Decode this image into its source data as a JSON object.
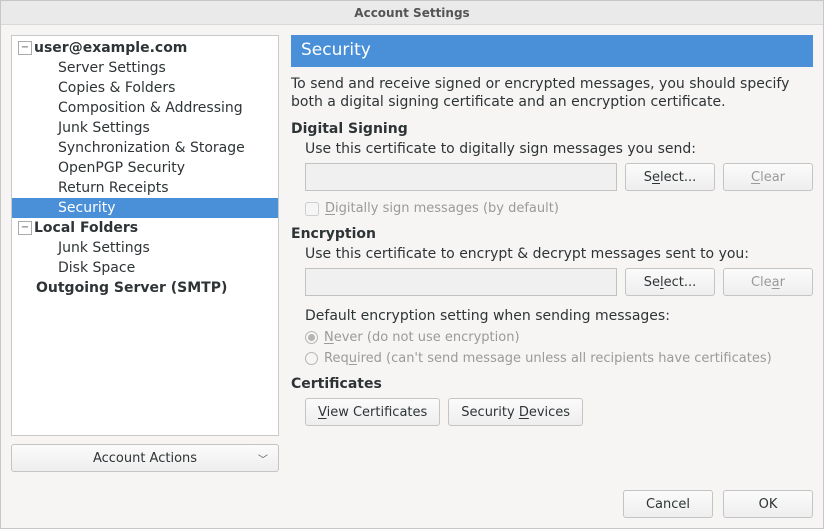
{
  "window": {
    "title": "Account Settings"
  },
  "tree": {
    "accounts": [
      {
        "label": "user@example.com",
        "expanded": true,
        "children": [
          {
            "label": "Server Settings"
          },
          {
            "label": "Copies & Folders"
          },
          {
            "label": "Composition & Addressing"
          },
          {
            "label": "Junk Settings"
          },
          {
            "label": "Synchronization & Storage"
          },
          {
            "label": "OpenPGP Security"
          },
          {
            "label": "Return Receipts"
          },
          {
            "label": "Security",
            "selected": true
          }
        ]
      },
      {
        "label": "Local Folders",
        "expanded": true,
        "children": [
          {
            "label": "Junk Settings"
          },
          {
            "label": "Disk Space"
          }
        ]
      },
      {
        "label": "Outgoing Server (SMTP)"
      }
    ]
  },
  "sidebar": {
    "actions_label": "Account Actions"
  },
  "panel": {
    "heading": "Security",
    "description": "To send and receive signed or encrypted messages, you should specify both a digital signing certificate and an encryption certificate.",
    "signing": {
      "title": "Digital Signing",
      "hint": "Use this certificate to digitally sign messages you send:",
      "value": "",
      "select_pre": "S",
      "select_mnem": "e",
      "select_post": "lect...",
      "clear_mnem": "C",
      "clear_post": "lear",
      "checkbox_pre": "",
      "checkbox_mnem": "D",
      "checkbox_post": "igitally sign messages (by default)"
    },
    "encryption": {
      "title": "Encryption",
      "hint": "Use this certificate to encrypt & decrypt messages sent to you:",
      "value": "",
      "select_pre": "Se",
      "select_mnem": "l",
      "select_post": "ect...",
      "clear_pre": "Cle",
      "clear_mnem": "a",
      "clear_post": "r",
      "default_label": "Default encryption setting when sending messages:",
      "never_mnem": "N",
      "never_post": "ever (do not use encryption)",
      "required_pre": "Req",
      "required_mnem": "u",
      "required_post": "ired (can't send message unless all recipients have certificates)"
    },
    "certs": {
      "title": "Certificates",
      "view_mnem": "V",
      "view_post": "iew Certificates",
      "devices_pre": "Security ",
      "devices_mnem": "D",
      "devices_post": "evices"
    }
  },
  "footer": {
    "cancel": "Cancel",
    "ok": "OK"
  }
}
